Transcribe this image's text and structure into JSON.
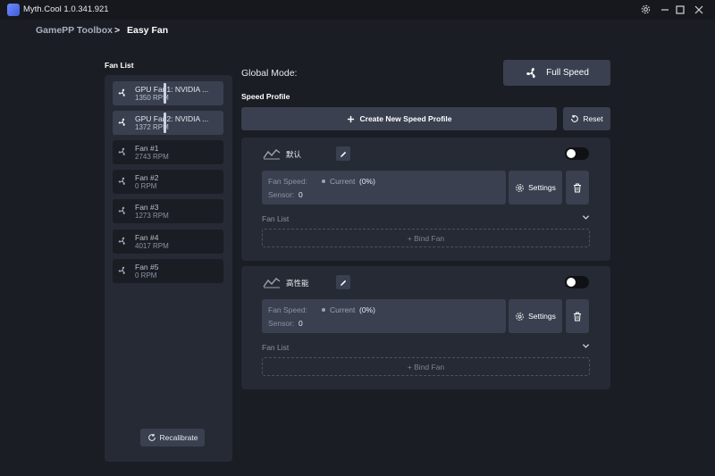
{
  "app": {
    "title": "Myth.Cool 1.0.341.921"
  },
  "breadcrumb": {
    "parent": "GamePP Toolbox",
    "separator": ">",
    "current": "Easy Fan"
  },
  "fan_list": {
    "title": "Fan List",
    "items": [
      {
        "name": "GPU Fan1: NVIDIA ...",
        "rpm": "1350 RPM"
      },
      {
        "name": "GPU Fan2: NVIDIA ...",
        "rpm": "1372 RPM"
      },
      {
        "name": "Fan #1",
        "rpm": "2743 RPM"
      },
      {
        "name": "Fan #2",
        "rpm": "0 RPM"
      },
      {
        "name": "Fan #3",
        "rpm": "1273 RPM"
      },
      {
        "name": "Fan #4",
        "rpm": "4017 RPM"
      },
      {
        "name": "Fan #5",
        "rpm": "0 RPM"
      }
    ],
    "recalibrate_label": "Recalibrate"
  },
  "global_mode": {
    "label": "Global Mode:",
    "button_label": "Full Speed"
  },
  "speed_profile": {
    "title": "Speed Profile",
    "create_label": "Create New Speed Profile",
    "reset_label": "Reset",
    "profiles": [
      {
        "name": "默认",
        "enabled": false,
        "fan_speed_label": "Fan Speed:",
        "current_label": "Current",
        "current_value": "(0%)",
        "sensor_label": "Sensor:",
        "sensor_value": "0",
        "settings_label": "Settings",
        "fan_list_label": "Fan List",
        "bind_fan_label": "+ Bind Fan"
      },
      {
        "name": "高性能",
        "enabled": false,
        "fan_speed_label": "Fan Speed:",
        "current_label": "Current",
        "current_value": "(0%)",
        "sensor_label": "Sensor:",
        "sensor_value": "0",
        "settings_label": "Settings",
        "fan_list_label": "Fan List",
        "bind_fan_label": "+ Bind Fan"
      }
    ]
  },
  "colors": {
    "background": "#1a1d23",
    "panel": "#262a34",
    "button": "#3a4050",
    "text": "#e6e9ef",
    "muted": "#8a92a2"
  },
  "icons": [
    "app-logo-icon",
    "gear-icon",
    "minimize-icon",
    "maximize-icon",
    "close-icon",
    "fan-icon",
    "refresh-icon",
    "plus-icon",
    "curve-icon",
    "pencil-icon",
    "trash-icon",
    "chevron-down-icon"
  ]
}
